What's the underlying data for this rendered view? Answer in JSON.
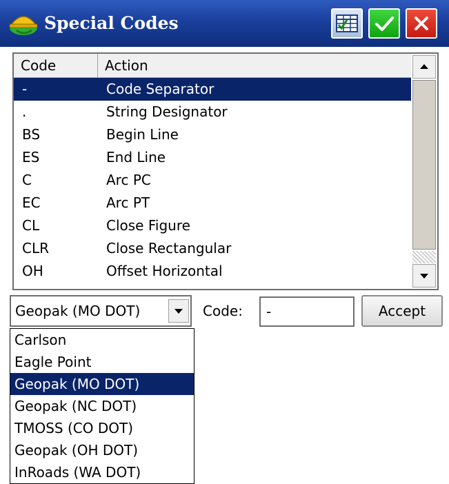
{
  "window": {
    "title": "Special Codes",
    "brand_color": "#1a3f9c"
  },
  "titlebar_buttons": {
    "grid": "grid-view-icon",
    "ok": "checkmark-icon",
    "cancel": "close-icon"
  },
  "table": {
    "columns": [
      "Code",
      "Action"
    ],
    "rows": [
      {
        "code": "-",
        "action": "Code Separator"
      },
      {
        "code": ".",
        "action": "String Designator"
      },
      {
        "code": "BS",
        "action": "Begin Line"
      },
      {
        "code": "ES",
        "action": "End Line"
      },
      {
        "code": "C",
        "action": "Arc PC"
      },
      {
        "code": "EC",
        "action": "Arc PT"
      },
      {
        "code": "CL",
        "action": "Close Figure"
      },
      {
        "code": "CLR",
        "action": "Close Rectangular"
      },
      {
        "code": "OH",
        "action": "Offset Horizontal"
      }
    ],
    "selected_index": 0
  },
  "controls": {
    "combo_value": "Geopak (MO DOT)",
    "code_label": "Code:",
    "code_value": "-",
    "accept_label": "Accept"
  },
  "dropdown": {
    "options": [
      "Carlson",
      "Eagle Point",
      "Geopak (MO DOT)",
      "Geopak (NC DOT)",
      "TMOSS (CO DOT)",
      "Geopak (OH DOT)",
      "InRoads (WA DOT)"
    ],
    "selected_index": 2
  }
}
